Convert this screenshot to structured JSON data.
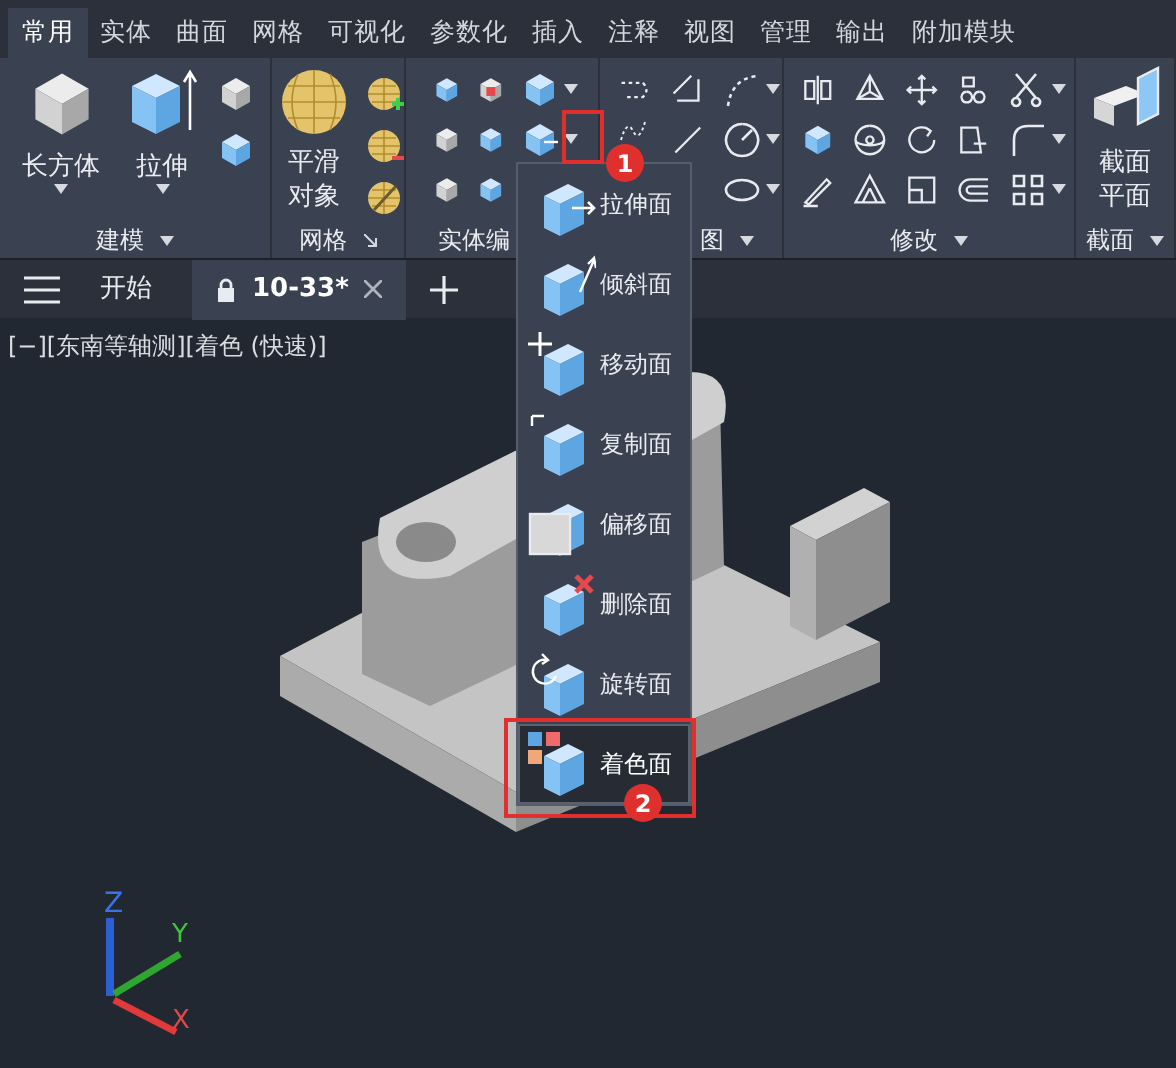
{
  "ribbon_tabs": [
    {
      "label": "常用",
      "selected": true
    },
    {
      "label": "实体",
      "selected": false
    },
    {
      "label": "曲面",
      "selected": false
    },
    {
      "label": "网格",
      "selected": false
    },
    {
      "label": "可视化",
      "selected": false
    },
    {
      "label": "参数化",
      "selected": false
    },
    {
      "label": "插入",
      "selected": false
    },
    {
      "label": "注释",
      "selected": false
    },
    {
      "label": "视图",
      "selected": false
    },
    {
      "label": "管理",
      "selected": false
    },
    {
      "label": "输出",
      "selected": false
    },
    {
      "label": "附加模块",
      "selected": false
    }
  ],
  "panels": [
    {
      "title": "建模",
      "title_menu": true,
      "large_buttons": [
        {
          "label": "长方体",
          "dropdown": true
        },
        {
          "label": "拉伸",
          "dropdown": true
        }
      ]
    },
    {
      "title": "网格",
      "title_launcher": true,
      "large_buttons": [
        {
          "label": "平滑对象",
          "dropdown": false
        }
      ]
    },
    {
      "title": "实体编"
    },
    {
      "title": "图",
      "title_menu": true
    },
    {
      "title": "修改",
      "title_menu": true
    },
    {
      "title": "截面",
      "title_menu": true,
      "large_buttons": [
        {
          "label": "截面平面",
          "dropdown": false
        }
      ]
    }
  ],
  "file_tabs": [
    {
      "label": "开始",
      "selected": false,
      "locked": false,
      "closable": false
    },
    {
      "label": "10-33*",
      "selected": true,
      "locked": true,
      "closable": true
    }
  ],
  "viewport": {
    "label": "[−][东南等轴测][着色 (快速)]",
    "axes": {
      "z": "Z",
      "y": "Y",
      "x": "X"
    }
  },
  "dropdown_menu": {
    "items": [
      {
        "label": "拉伸面",
        "selected": false
      },
      {
        "label": "倾斜面",
        "selected": false
      },
      {
        "label": "移动面",
        "selected": false
      },
      {
        "label": "复制面",
        "selected": false
      },
      {
        "label": "偏移面",
        "selected": false
      },
      {
        "label": "删除面",
        "selected": false
      },
      {
        "label": "旋转面",
        "selected": false
      },
      {
        "label": "着色面",
        "selected": true
      }
    ]
  },
  "annotations": [
    {
      "label": "1"
    },
    {
      "label": "2"
    }
  ]
}
